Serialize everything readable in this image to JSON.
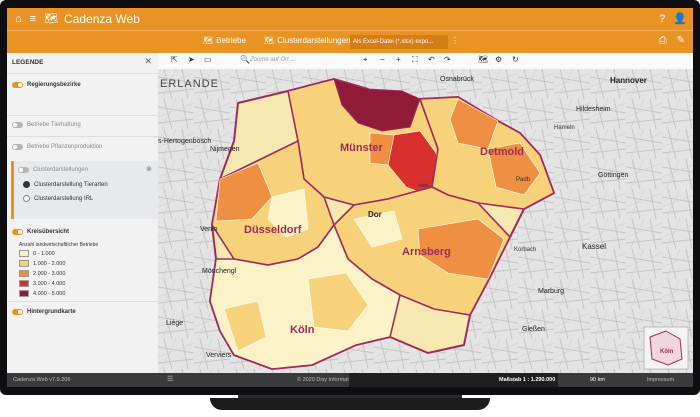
{
  "app": {
    "title": "Cadenza Web"
  },
  "toolbar": {
    "betriebe": "Betriebe",
    "clusterdarstellungen": "Clusterdarstellungen",
    "export": "Als Excel-Datei (*.xlsx) expo...",
    "more": "⋮"
  },
  "map_toolbar": {
    "search_placeholder": "Zoome auf Ort ..."
  },
  "legend": {
    "header": "LEGENDE",
    "regierungsbezirke": "Regierungsbezirke",
    "tierhaltung": "Betriebe Tierhaltung",
    "pflanzenproduktion": "Betriebe Pflanzenproduktion",
    "clusterdarstellungen": "Clusterdarstellungen",
    "cluster_tierarten": "Clusterdarstellung Tierarten",
    "cluster_irl": "Clusterdarstellung IRL",
    "kreisuebersicht": "Kreisübersicht",
    "subtitle": "Anzahl landwirtschaftlicher Betriebe",
    "classes": [
      {
        "label": "0 - 1.000",
        "color": "#fbf2c7"
      },
      {
        "label": "1.000 - 2.000",
        "color": "#f8d27b"
      },
      {
        "label": "2.000 - 3.000",
        "color": "#ee8f41"
      },
      {
        "label": "3.000 - 4.000",
        "color": "#d8302c"
      },
      {
        "label": "4.000 - 5.000",
        "color": "#8f1b39"
      }
    ],
    "hintergrundkarte": "Hintergrundkarte"
  },
  "map_labels": {
    "muenster": "Münster",
    "detmold": "Detmold",
    "duesseldorf": "Düsseldorf",
    "arnsberg": "Arnsberg",
    "koeln": "Köln",
    "erlande": "ERLANDE",
    "osnabrueck": "Osnabrück",
    "hannover": "Hannover",
    "hildesheim": "Hildesheim",
    "goettingen": "Göttingen",
    "kassel": "Kassel",
    "marburg": "Marburg",
    "giessen": "Gießen",
    "nijmegen": "Nijmegen",
    "hertogenbosch": "s-Hertogenbosch",
    "venlo": "Venlo",
    "moenchengl": "Mönchengl",
    "liege": "Liège",
    "verviers": "Verviers",
    "korbach": "Korbach",
    "dortmund": "Dor",
    "hameln": "Hameln",
    "padb": "Padb",
    "insel": "Insel"
  },
  "minimap": {
    "label": "Köln"
  },
  "status": {
    "version": "Cadenza Web v7.9.206",
    "copyright": "© 2020 Disy Informationssysteme GmbH",
    "scale": "Maßstab 1 : 1.290.000",
    "distance": "90 km",
    "impressum": "Impressum"
  }
}
